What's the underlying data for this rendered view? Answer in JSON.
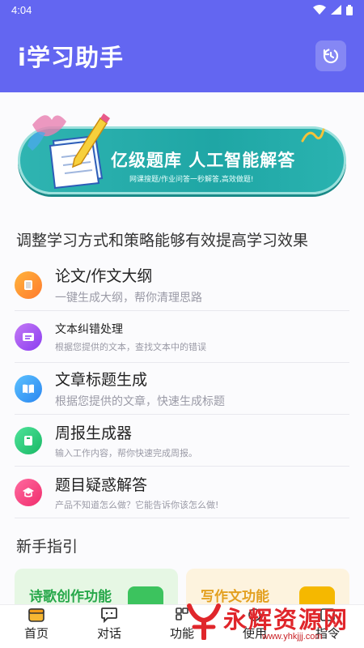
{
  "status_bar": {
    "time": "4:04"
  },
  "app_bar": {
    "title": "i学习助手",
    "history_icon": "history-icon"
  },
  "banner": {
    "title": "亿级题库  人工智能解答",
    "subtitle": "网课搜题/作业问答一秒解答,高效做题!"
  },
  "section_tools": {
    "title": "调整学习方式和策略能够有效提高学习效果"
  },
  "tools": [
    {
      "title": "论文/作文大纲",
      "desc": "一键生成大纲，帮你清理思路",
      "icon": "document-icon",
      "color_a": "#ffb43c",
      "color_b": "#ff7a2e"
    },
    {
      "title": "文本纠错处理",
      "desc": "根据您提供的文本，查找文本中的错误",
      "icon": "text-correct-icon",
      "color_a": "#c47af5",
      "color_b": "#8a3cf0"
    },
    {
      "title": "文章标题生成",
      "desc": "根据您提供的文章，快速生成标题",
      "icon": "book-icon",
      "color_a": "#5cc1ff",
      "color_b": "#2a86f0"
    },
    {
      "title": "周报生成器",
      "desc": "输入工作内容，帮你快速完成周报。",
      "icon": "report-icon",
      "color_a": "#4fe39a",
      "color_b": "#19b865"
    },
    {
      "title": "题目疑惑解答",
      "desc": "产品不知道怎么做？它能告诉你该怎么做!",
      "icon": "answer-icon",
      "color_a": "#ff6aa0",
      "color_b": "#f02d6c"
    }
  ],
  "section_guide": {
    "title": "新手指引"
  },
  "guide_cards": [
    {
      "label": "诗歌创作功能",
      "bg": "#e6f7e4",
      "color": "#27a84a",
      "icon_color": "#3cc35e"
    },
    {
      "label": "写作文功能",
      "bg": "#fdf3de",
      "color": "#e3a020",
      "icon_color": "#f5b800"
    }
  ],
  "tabs": [
    {
      "label": "首页",
      "icon": "home-icon"
    },
    {
      "label": "对话",
      "icon": "chat-icon"
    },
    {
      "label": "功能",
      "icon": "function-icon"
    },
    {
      "label": "使用",
      "icon": "usage-icon"
    },
    {
      "label": "指令",
      "icon": "command-icon"
    }
  ],
  "watermark": {
    "text": "永辉资源网",
    "url": "www.yhkjjj.com"
  }
}
